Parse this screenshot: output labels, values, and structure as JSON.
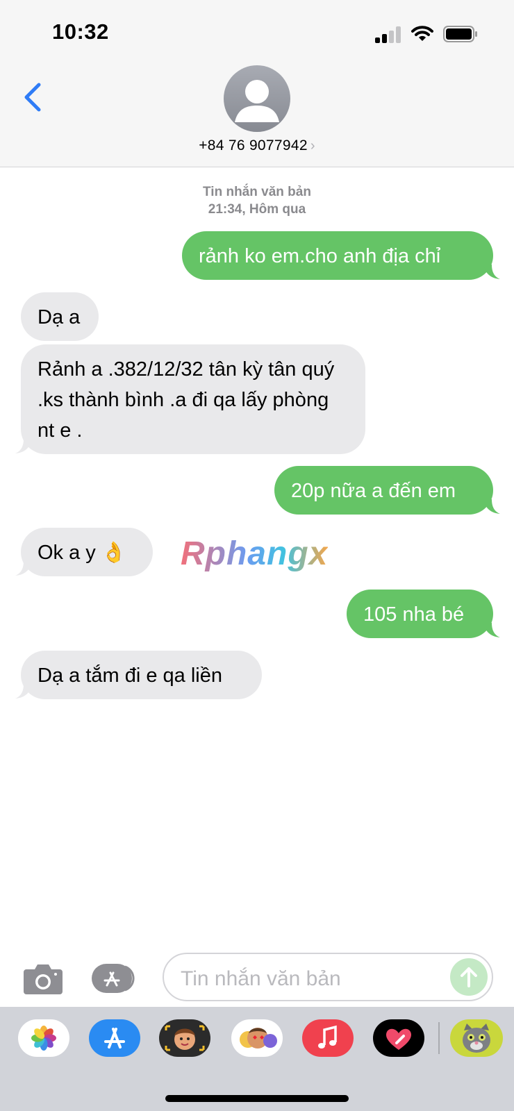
{
  "status_bar": {
    "time": "10:32"
  },
  "header": {
    "contact": "+84 76 9077942",
    "chevron": "›"
  },
  "conversation": {
    "service_label": "Tin nhắn văn bản",
    "timestamp": "21:34, Hôm qua",
    "messages": [
      {
        "direction": "outgoing",
        "text": "rảnh ko em.cho anh địa chỉ"
      },
      {
        "direction": "incoming",
        "text": "Dạ a"
      },
      {
        "direction": "incoming",
        "text": "Rảnh a .382/12/32 tân kỳ tân quý .ks thành bình .a đi qa lấy phòng nt e ."
      },
      {
        "direction": "outgoing",
        "text": "20p nữa a đến em"
      },
      {
        "direction": "incoming",
        "text": "Ok a y 👌"
      },
      {
        "direction": "outgoing",
        "text": "105 nha bé"
      },
      {
        "direction": "incoming",
        "text": "Dạ a tắm đi e qa liền"
      }
    ]
  },
  "watermark": "Rphangx",
  "composer": {
    "placeholder": "Tin nhắn văn bản"
  },
  "app_drawer": {
    "apps": [
      "photos-icon",
      "app-store-icon",
      "memoji-icon",
      "animoji-icon",
      "music-icon",
      "digital-touch-icon",
      "talking-tom-icon"
    ]
  },
  "colors": {
    "outgoing_bubble": "#65c466",
    "incoming_bubble": "#e9e9eb",
    "accent_blue": "#2f7cf6"
  }
}
